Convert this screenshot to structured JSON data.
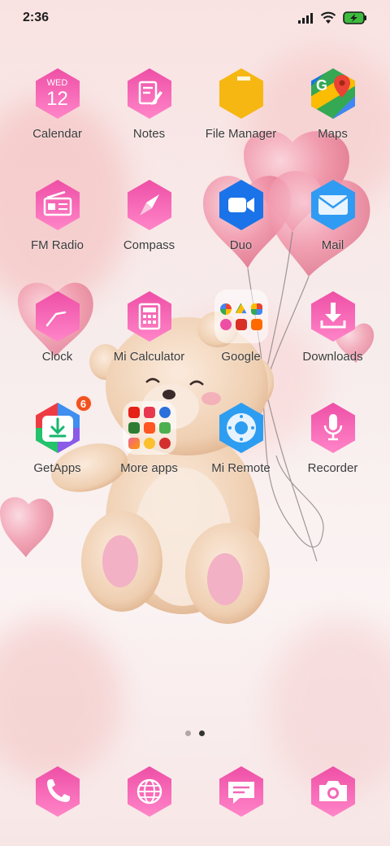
{
  "status_bar": {
    "time": "2:36",
    "icons": [
      "signal-icon",
      "wifi-icon",
      "battery-charging-icon"
    ]
  },
  "calendar_icon": {
    "weekday": "WED",
    "day": "12"
  },
  "apps": [
    {
      "name": "Calendar",
      "icon": "calendar-icon"
    },
    {
      "name": "Notes",
      "icon": "notes-icon"
    },
    {
      "name": "File Manager",
      "icon": "file-manager-icon"
    },
    {
      "name": "Maps",
      "icon": "maps-icon"
    },
    {
      "name": "FM Radio",
      "icon": "radio-icon"
    },
    {
      "name": "Compass",
      "icon": "compass-icon"
    },
    {
      "name": "Duo",
      "icon": "video-camera-icon"
    },
    {
      "name": "Mail",
      "icon": "mail-icon"
    },
    {
      "name": "Clock",
      "icon": "clock-icon"
    },
    {
      "name": "Mi Calculator",
      "icon": "calculator-icon"
    },
    {
      "name": "Google",
      "icon": "google-folder-icon"
    },
    {
      "name": "Downloads",
      "icon": "download-icon"
    },
    {
      "name": "GetApps",
      "icon": "getapps-icon",
      "badge": "6"
    },
    {
      "name": "More apps",
      "icon": "more-apps-folder-icon"
    },
    {
      "name": "Mi Remote",
      "icon": "remote-icon"
    },
    {
      "name": "Recorder",
      "icon": "microphone-icon"
    }
  ],
  "page_indicator": {
    "pages": 2,
    "active": 2
  },
  "dock": [
    {
      "icon": "phone-icon"
    },
    {
      "icon": "browser-globe-icon"
    },
    {
      "icon": "messages-icon"
    },
    {
      "icon": "camera-icon"
    }
  ],
  "colors": {
    "hex_gradient_top": "#ee4fa6",
    "hex_gradient_bottom": "#ff85c8",
    "badge": "#f2521f",
    "file_manager": "#f6b713",
    "duo_blue": "#1a73e8",
    "mail_blue": "#2f9bf2",
    "remote_blue": "#2d9df2"
  }
}
